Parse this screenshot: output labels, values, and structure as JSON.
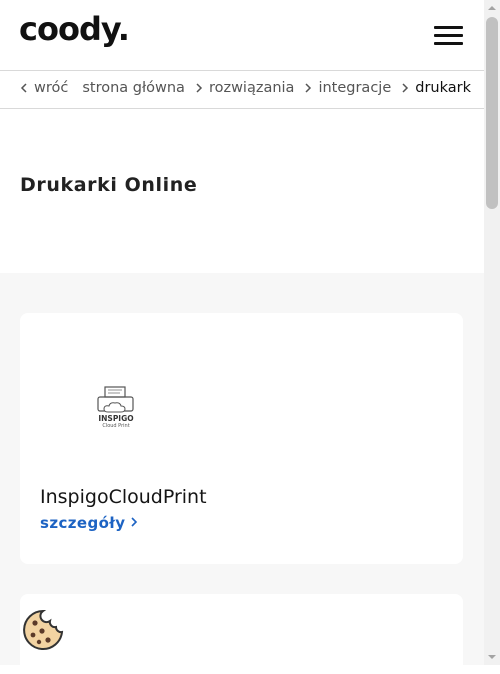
{
  "header": {
    "logo_text": "coody.",
    "menu_icon": "hamburger-menu-icon"
  },
  "breadcrumb": {
    "back": "wróć",
    "items": [
      "strona główna",
      "rozwiązania",
      "integracje"
    ],
    "current": "drukark"
  },
  "page": {
    "title": "Drukarki Online"
  },
  "cards": [
    {
      "logo_text": "INSPIGO",
      "logo_subtext": "Cloud Print",
      "name": "InspigoCloudPrint",
      "link_label": "szczegóły"
    }
  ],
  "cookie_icon": "cookie-icon",
  "colors": {
    "accent": "#1d63c3",
    "background_gray": "#f7f7f7",
    "text": "#1f1f1f"
  }
}
